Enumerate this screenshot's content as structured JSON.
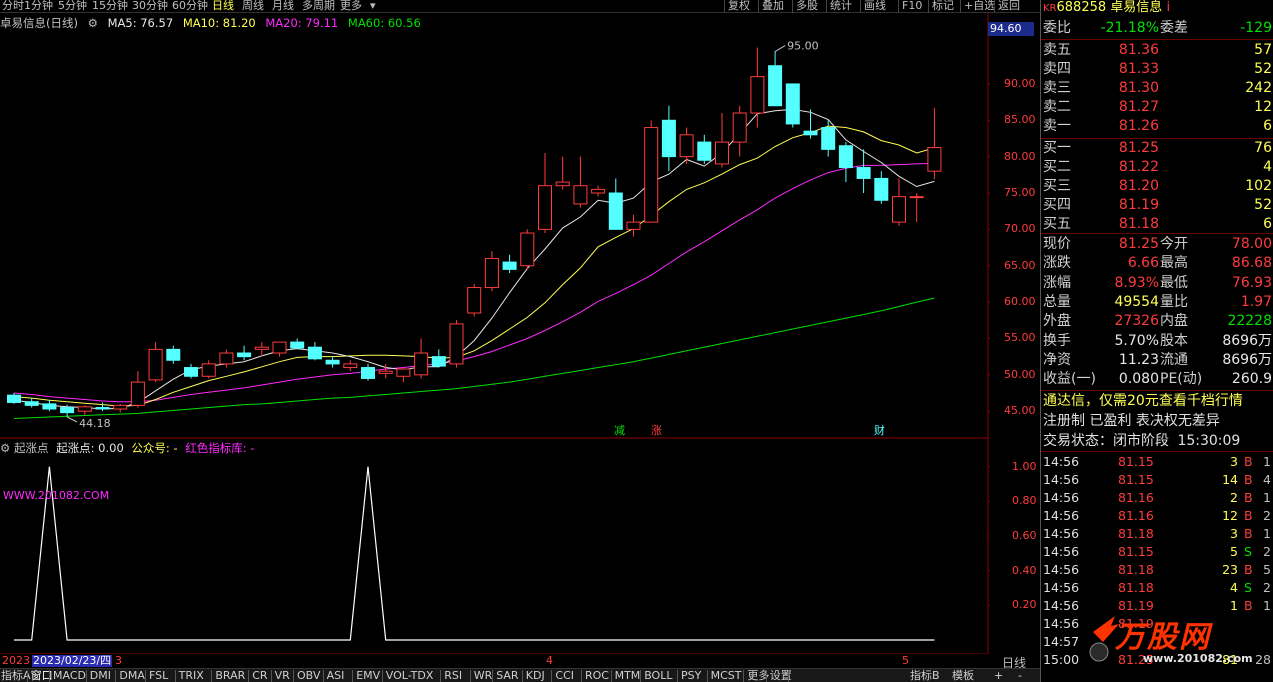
{
  "toolbar": {
    "periods": [
      "分时",
      "1分钟",
      "5分钟",
      "15分钟",
      "30分钟",
      "60分钟",
      "日线",
      "周线",
      "月线",
      "多周期",
      "更多"
    ],
    "active_period": "日线",
    "right_buttons": [
      "复权",
      "叠加",
      "多股",
      "统计",
      "画线",
      "F10",
      "标记",
      "+自选",
      "返回"
    ]
  },
  "ma_line": {
    "title": "卓易信息(日线)",
    "ma5": "MA5: 76.57",
    "ma10": "MA10: 81.20",
    "ma20": "MA20: 79.11",
    "ma60": "MA60: 60.56"
  },
  "colors": {
    "up": "#ff3c3c",
    "down": "#54ffff",
    "ma5": "#e8e8e8",
    "ma10": "#ffff54",
    "ma20": "#ff2bff",
    "ma60": "#00e000"
  },
  "price_axis": [
    "90.00",
    "85.00",
    "80.00",
    "75.00",
    "70.00",
    "65.00",
    "60.00",
    "55.00",
    "50.00",
    "45.00"
  ],
  "current_price_tag": "94.60",
  "chart_markers": {
    "high": "95.00",
    "low": "44.18",
    "events": [
      "减",
      "涨",
      "财"
    ]
  },
  "indicator": {
    "name": "起涨点",
    "value": "起涨点: 0.00",
    "extra": "公众号: -",
    "lib": "红色指标库: -",
    "watermark": "WWW.201082.COM",
    "axis": [
      "1.00",
      "0.80",
      "0.60",
      "0.40",
      "0.20"
    ]
  },
  "date_axis": {
    "year": "2023",
    "cursor_date": "2023/02/23/四",
    "months": [
      "3",
      "4",
      "5"
    ],
    "period_label": "日线"
  },
  "bottom_tabs": [
    "指标A",
    "窗口",
    "MACD",
    "DMI",
    "DMA",
    "FSL",
    "TRIX",
    "BRAR",
    "CR",
    "VR",
    "OBV",
    "ASI",
    "EMV",
    "VOL-TDX",
    "RSI",
    "WR",
    "SAR",
    "KDJ",
    "CCI",
    "ROC",
    "MTM",
    "BOLL",
    "PSY",
    "MCST",
    "更多",
    "设置"
  ],
  "bottom_right_tabs": [
    "指标B",
    "模板",
    "+",
    "-"
  ],
  "quote": {
    "code": "688258",
    "name": "卓易信息",
    "kr": "KR",
    "weibi_label": "委比",
    "weibi": "-21.18%",
    "weicha_label": "委差",
    "weicha": "-129",
    "asks": [
      {
        "label": "卖五",
        "price": "81.36",
        "vol": "57"
      },
      {
        "label": "卖四",
        "price": "81.33",
        "vol": "52"
      },
      {
        "label": "卖三",
        "price": "81.30",
        "vol": "242"
      },
      {
        "label": "卖二",
        "price": "81.27",
        "vol": "12"
      },
      {
        "label": "卖一",
        "price": "81.26",
        "vol": "6"
      }
    ],
    "bids": [
      {
        "label": "买一",
        "price": "81.25",
        "vol": "76"
      },
      {
        "label": "买二",
        "price": "81.22",
        "vol": "4"
      },
      {
        "label": "买三",
        "price": "81.20",
        "vol": "102"
      },
      {
        "label": "买四",
        "price": "81.19",
        "vol": "52"
      },
      {
        "label": "买五",
        "price": "81.18",
        "vol": "6"
      }
    ],
    "stats": [
      {
        "l1": "现价",
        "v1": "81.25",
        "l2": "今开",
        "v2": "78.00",
        "c1": "red",
        "c2": "red"
      },
      {
        "l1": "涨跌",
        "v1": "6.66",
        "l2": "最高",
        "v2": "86.68",
        "c1": "red",
        "c2": "red"
      },
      {
        "l1": "涨幅",
        "v1": "8.93%",
        "l2": "最低",
        "v2": "76.93",
        "c1": "red",
        "c2": "red"
      },
      {
        "l1": "总量",
        "v1": "49554",
        "l2": "量比",
        "v2": "1.97",
        "c1": "yellow",
        "c2": "red"
      },
      {
        "l1": "外盘",
        "v1": "27326",
        "l2": "内盘",
        "v2": "22228",
        "c1": "red",
        "c2": "green"
      },
      {
        "l1": "换手",
        "v1": "5.70%",
        "l2": "股本",
        "v2": "8696万",
        "c1": "white",
        "c2": "white"
      },
      {
        "l1": "净资",
        "v1": "11.23",
        "l2": "流通",
        "v2": "8696万",
        "c1": "white",
        "c2": "white"
      },
      {
        "l1": "收益(一)",
        "v1": "0.080",
        "l2": "PE(动)",
        "v2": "260.9",
        "c1": "white",
        "c2": "white"
      }
    ],
    "notice1": "通达信，仅需20元查看千档行情",
    "notice2": "注册制 已盈利 表决权无差异",
    "status_label": "交易状态：闭市阶段",
    "status_time": "15:30:09",
    "trades": [
      {
        "t": "14:56",
        "p": "81.15",
        "v": "3",
        "bs": "B",
        "n": "1"
      },
      {
        "t": "14:56",
        "p": "81.15",
        "v": "14",
        "bs": "B",
        "n": "4"
      },
      {
        "t": "14:56",
        "p": "81.16",
        "v": "2",
        "bs": "B",
        "n": "1"
      },
      {
        "t": "14:56",
        "p": "81.16",
        "v": "12",
        "bs": "B",
        "n": "2"
      },
      {
        "t": "14:56",
        "p": "81.18",
        "v": "3",
        "bs": "B",
        "n": "1"
      },
      {
        "t": "14:56",
        "p": "81.15",
        "v": "5",
        "bs": "S",
        "n": "2"
      },
      {
        "t": "14:56",
        "p": "81.18",
        "v": "23",
        "bs": "B",
        "n": "5"
      },
      {
        "t": "14:56",
        "p": "81.18",
        "v": "4",
        "bs": "S",
        "n": "2"
      },
      {
        "t": "14:56",
        "p": "81.19",
        "v": "1",
        "bs": "B",
        "n": "1"
      },
      {
        "t": "14:56",
        "p": "81.19",
        "v": "",
        "bs": "",
        "n": ""
      },
      {
        "t": "14:57",
        "p": "",
        "v": "",
        "bs": "",
        "n": ""
      },
      {
        "t": "15:00",
        "p": "81.25",
        "v": "81",
        "bs": "",
        "n": "28"
      }
    ],
    "logo_text": "万股网",
    "logo_url": "www.201082.com"
  },
  "chart_data": {
    "type": "candlestick",
    "ylim": [
      42,
      97
    ],
    "candles": [
      [
        47.2,
        47.5,
        46.0,
        46.2
      ],
      [
        46.3,
        46.8,
        45.5,
        45.8
      ],
      [
        46.0,
        46.5,
        45.0,
        45.3
      ],
      [
        45.5,
        45.9,
        44.2,
        44.8
      ],
      [
        45.0,
        45.8,
        44.5,
        45.6
      ],
      [
        45.5,
        46.2,
        45.0,
        45.3
      ],
      [
        45.3,
        46.0,
        44.8,
        45.8
      ],
      [
        45.8,
        50.5,
        45.5,
        49.0
      ],
      [
        49.3,
        54.5,
        49.0,
        53.5
      ],
      [
        53.5,
        54.0,
        51.5,
        52.0
      ],
      [
        51.0,
        51.5,
        49.5,
        49.8
      ],
      [
        49.8,
        52.0,
        49.5,
        51.5
      ],
      [
        51.5,
        53.5,
        51.0,
        53.0
      ],
      [
        53.0,
        54.0,
        52.0,
        52.5
      ],
      [
        53.5,
        54.5,
        52.5,
        53.8
      ],
      [
        53.0,
        54.5,
        52.5,
        54.5
      ],
      [
        54.5,
        55.0,
        53.5,
        53.7
      ],
      [
        53.8,
        54.5,
        52.0,
        52.2
      ],
      [
        52.0,
        52.5,
        51.0,
        51.5
      ],
      [
        51.0,
        52.0,
        50.5,
        51.5
      ],
      [
        51.0,
        51.5,
        49.2,
        49.5
      ],
      [
        50.2,
        51.5,
        49.5,
        50.5
      ],
      [
        49.8,
        51.0,
        49.0,
        50.8
      ],
      [
        50.0,
        55.0,
        49.5,
        53.0
      ],
      [
        52.5,
        53.5,
        51.0,
        51.2
      ],
      [
        51.5,
        57.5,
        51.0,
        57.0
      ],
      [
        58.5,
        62.5,
        58.0,
        62.0
      ],
      [
        62.0,
        67.0,
        61.5,
        66.0
      ],
      [
        65.5,
        66.5,
        64.0,
        64.5
      ],
      [
        65.0,
        70.0,
        64.5,
        69.5
      ],
      [
        70.0,
        80.5,
        69.5,
        76.0
      ],
      [
        76.0,
        80.0,
        75.5,
        76.5
      ],
      [
        73.5,
        80.0,
        73.0,
        76.0
      ],
      [
        75.0,
        76.0,
        74.5,
        75.5
      ],
      [
        75.0,
        77.0,
        70.0,
        70.0
      ],
      [
        70.0,
        72.0,
        69.0,
        71.0
      ],
      [
        71.0,
        85.0,
        71.0,
        84.0
      ],
      [
        85.0,
        87.0,
        78.0,
        80.0
      ],
      [
        80.0,
        84.0,
        79.0,
        83.0
      ],
      [
        82.0,
        83.0,
        79.0,
        79.5
      ],
      [
        79.0,
        86.0,
        78.5,
        82.0
      ],
      [
        82.0,
        87.0,
        80.0,
        86.0
      ],
      [
        86.0,
        95.0,
        84.0,
        91.0
      ],
      [
        92.5,
        94.5,
        88.0,
        87.0
      ],
      [
        90.0,
        90.0,
        84.0,
        84.5
      ],
      [
        83.5,
        86.5,
        82.5,
        83.0
      ],
      [
        84.0,
        85.0,
        80.0,
        81.0
      ],
      [
        81.5,
        82.0,
        76.5,
        78.5
      ],
      [
        78.5,
        81.0,
        75.0,
        77.0
      ],
      [
        77.0,
        78.0,
        73.5,
        74.0
      ],
      [
        71.0,
        77.0,
        70.5,
        74.5
      ],
      [
        74.5,
        75.0,
        71.0,
        74.5
      ],
      [
        78.0,
        86.7,
        76.9,
        81.25
      ]
    ],
    "ma5": [
      46.5,
      46.2,
      45.8,
      45.6,
      45.5,
      45.3,
      45.4,
      46.2,
      47.8,
      49.4,
      50.7,
      51.2,
      51.5,
      51.8,
      52.6,
      53.3,
      53.6,
      53.3,
      53.0,
      52.5,
      51.8,
      51.0,
      50.7,
      51.1,
      51.1,
      52.5,
      54.7,
      57.8,
      61.3,
      64.6,
      67.3,
      70.2,
      71.7,
      74.0,
      73.6,
      74.3,
      76.5,
      77.6,
      79.6,
      78.7,
      80.5,
      83.2,
      85.9,
      86.3,
      86.5,
      86.1,
      85.1,
      82.3,
      80.7,
      79.2,
      77.3,
      75.9,
      76.6
    ],
    "ma10": [
      47.0,
      46.8,
      46.5,
      46.3,
      46.1,
      45.9,
      45.7,
      45.8,
      46.6,
      47.6,
      48.4,
      49.2,
      49.8,
      50.4,
      51.1,
      51.8,
      52.4,
      52.5,
      52.5,
      52.6,
      52.7,
      52.7,
      52.6,
      52.5,
      52.3,
      52.4,
      53.3,
      54.7,
      56.3,
      57.9,
      59.9,
      62.4,
      64.7,
      67.6,
      68.9,
      70.1,
      71.9,
      73.8,
      75.5,
      76.4,
      77.6,
      78.9,
      79.8,
      81.4,
      82.6,
      83.3,
      84.2,
      84.0,
      83.4,
      82.2,
      81.6,
      80.5,
      81.2
    ],
    "ma20": [
      47.5,
      47.3,
      47.0,
      46.8,
      46.6,
      46.4,
      46.3,
      46.3,
      46.5,
      46.9,
      47.3,
      47.6,
      47.9,
      48.2,
      48.6,
      49.0,
      49.4,
      49.7,
      50.0,
      50.2,
      50.5,
      50.8,
      51.0,
      51.3,
      51.5,
      51.9,
      52.5,
      53.2,
      54.1,
      55.0,
      56.1,
      57.3,
      58.6,
      60.1,
      61.2,
      62.4,
      63.7,
      65.3,
      66.9,
      68.3,
      69.8,
      71.3,
      72.7,
      74.3,
      75.6,
      76.8,
      77.8,
      78.4,
      78.8,
      78.8,
      78.9,
      79.0,
      79.1
    ],
    "ma60": [
      44.0,
      44.1,
      44.2,
      44.3,
      44.4,
      44.5,
      44.6,
      44.7,
      44.9,
      45.1,
      45.3,
      45.5,
      45.7,
      45.9,
      46.0,
      46.2,
      46.4,
      46.6,
      46.8,
      46.9,
      47.1,
      47.3,
      47.5,
      47.7,
      47.9,
      48.1,
      48.4,
      48.7,
      49.0,
      49.4,
      49.8,
      50.2,
      50.6,
      51.0,
      51.4,
      51.8,
      52.3,
      52.8,
      53.3,
      53.8,
      54.3,
      54.8,
      55.3,
      55.8,
      56.3,
      56.8,
      57.3,
      57.8,
      58.3,
      58.8,
      59.4,
      60.0,
      60.56
    ],
    "signal_peaks": [
      2,
      20
    ]
  }
}
